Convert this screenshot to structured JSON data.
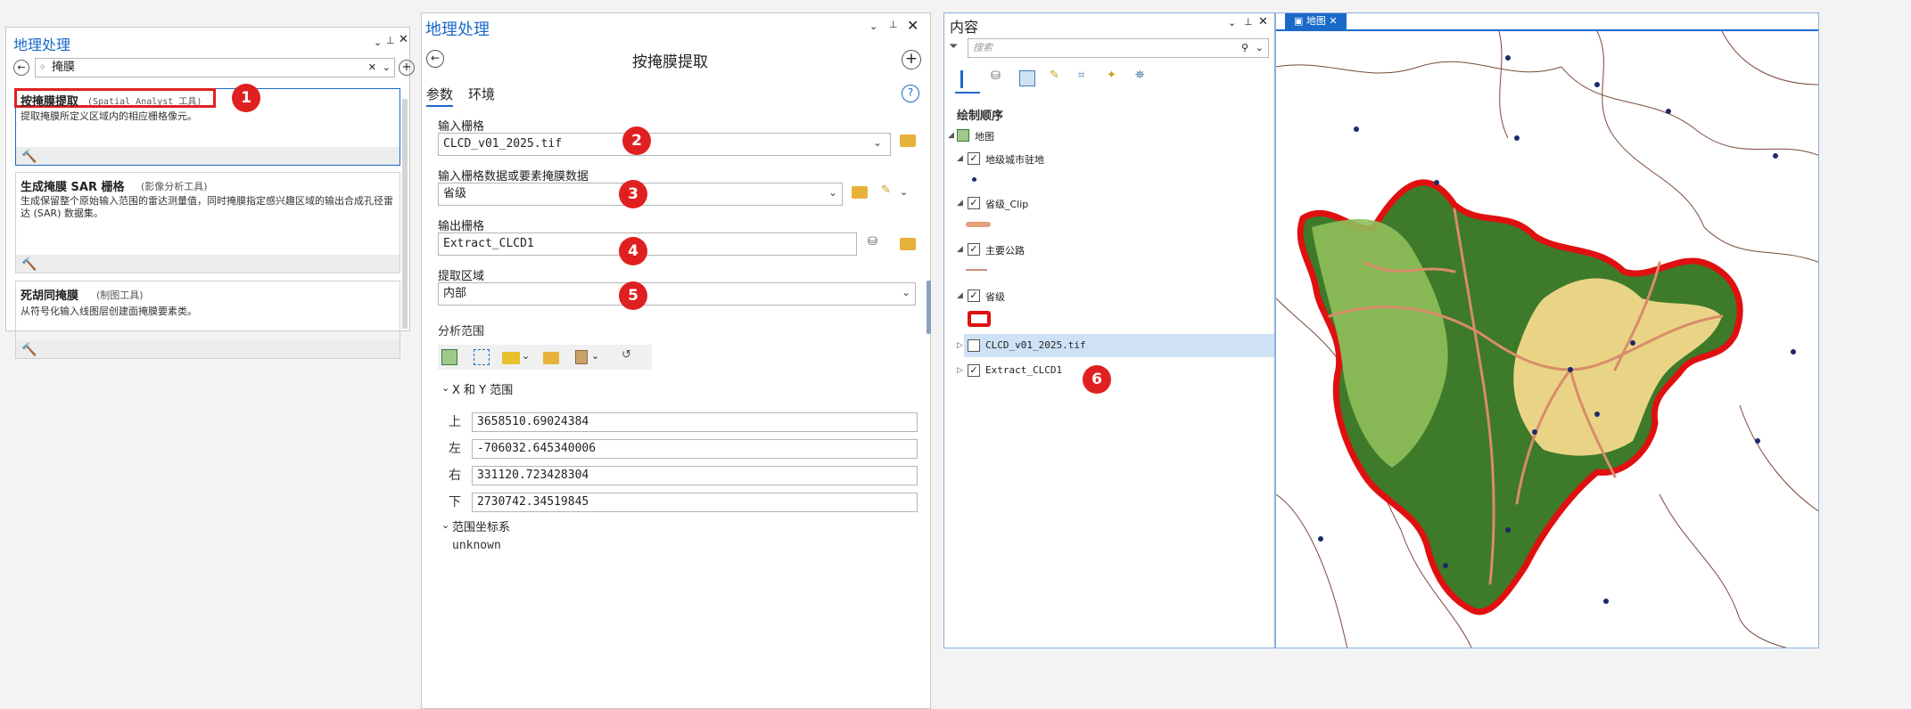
{
  "left_panel": {
    "title": "地理处理",
    "search_value": "掩膜",
    "results": [
      {
        "name": "按掩膜提取",
        "tag": "(Spatial Analyst 工具)",
        "desc": "提取掩膜所定义区域内的相应栅格像元。"
      },
      {
        "name": "生成掩膜 SAR 栅格",
        "tag": "(影像分析工具)",
        "desc": "生成保留整个原始输入范围的雷达测量值，同时掩膜指定感兴趣区域的输出合成孔径雷达 (SAR) 数据集。"
      },
      {
        "name": "死胡同掩膜",
        "tag": "(制图工具)",
        "desc": "从符号化输入线图层创建面掩膜要素类。"
      }
    ]
  },
  "tool_panel": {
    "title": "地理处理",
    "tool_name": "按掩膜提取",
    "tabs": [
      "参数",
      "环境"
    ],
    "input_raster_label": "输入栅格",
    "input_raster_value": "CLCD_v01_2025.tif",
    "mask_label": "输入栅格数据或要素掩膜数据",
    "mask_value": "省级",
    "output_label": "输出栅格",
    "output_value": "Extract_CLCD1",
    "extract_area_label": "提取区域",
    "extract_area_value": "内部",
    "analysis_extent_label": "分析范围",
    "xy_extent_label": "X 和 Y 范围",
    "coords": [
      {
        "label": "上",
        "value": "3658510.69024384"
      },
      {
        "label": "左",
        "value": "-706032.645340006"
      },
      {
        "label": "右",
        "value": "331120.723428304"
      },
      {
        "label": "下",
        "value": "2730742.34519845"
      }
    ],
    "crs_label": "范围坐标系",
    "crs_value": "unknown"
  },
  "contents": {
    "title": "内容",
    "search_placeholder": "搜索",
    "drawing_order_label": "绘制顺序",
    "map_label": "地图",
    "layers": [
      {
        "name": "地级城市驻地",
        "checked": true
      },
      {
        "name": "省级_Clip",
        "checked": true
      },
      {
        "name": "主要公路",
        "checked": true
      },
      {
        "name": "省级",
        "checked": true
      },
      {
        "name": "CLCD_v01_2025.tif",
        "checked": false
      },
      {
        "name": "Extract_CLCD1",
        "checked": true
      }
    ]
  },
  "map_view": {
    "tab_label": "地图"
  },
  "badges": [
    "1",
    "2",
    "3",
    "4",
    "5",
    "6"
  ],
  "colors": {
    "accent": "#1b6ac9",
    "badge": "#e02020",
    "boundary": "#e01010",
    "forest": "#3d7a2a",
    "grass": "#8fbf5a",
    "crop": "#f2d98a",
    "road": "#d98c6a"
  }
}
